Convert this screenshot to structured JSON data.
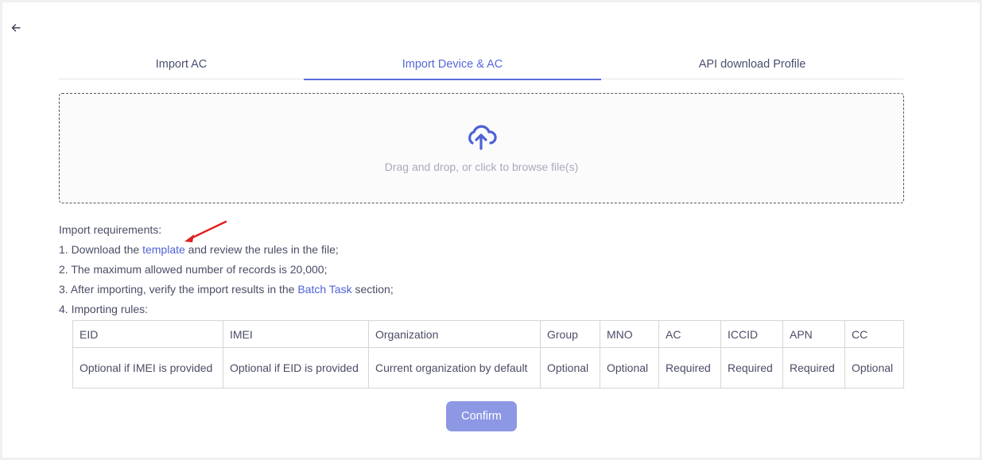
{
  "nav": {
    "back_icon": "arrow-left-icon"
  },
  "tabs": [
    {
      "label": "Import AC",
      "active": false
    },
    {
      "label": "Import Device & AC",
      "active": true
    },
    {
      "label": "API download Profile",
      "active": false
    }
  ],
  "colors": {
    "accent": "#5b6ddb",
    "link": "#4f62d6",
    "button": "#8c98e4",
    "annotation_arrow": "#e02020"
  },
  "dropzone": {
    "icon": "cloud-upload-icon",
    "text": "Drag and drop, or click to browse file(s)"
  },
  "requirements": {
    "title": "Import requirements:",
    "item1": {
      "prefix": "1. Download the ",
      "link": "template",
      "suffix": " and review the rules in the file;"
    },
    "item2": "2. The maximum allowed number of records is 20,000;",
    "item3": {
      "prefix": "3. After importing, verify the import results in the ",
      "link": "Batch Task",
      "suffix": " section;"
    },
    "item4": "4. Importing rules:"
  },
  "rules_table": {
    "headers": [
      "EID",
      "IMEI",
      "Organization",
      "Group",
      "MNO",
      "AC",
      "ICCID",
      "APN",
      "CC"
    ],
    "values": [
      "Optional if IMEI is provided",
      "Optional if EID is provided",
      "Current organization by default",
      "Optional",
      "Optional",
      "Required",
      "Required",
      "Required",
      "Optional"
    ]
  },
  "actions": {
    "confirm_label": "Confirm"
  }
}
